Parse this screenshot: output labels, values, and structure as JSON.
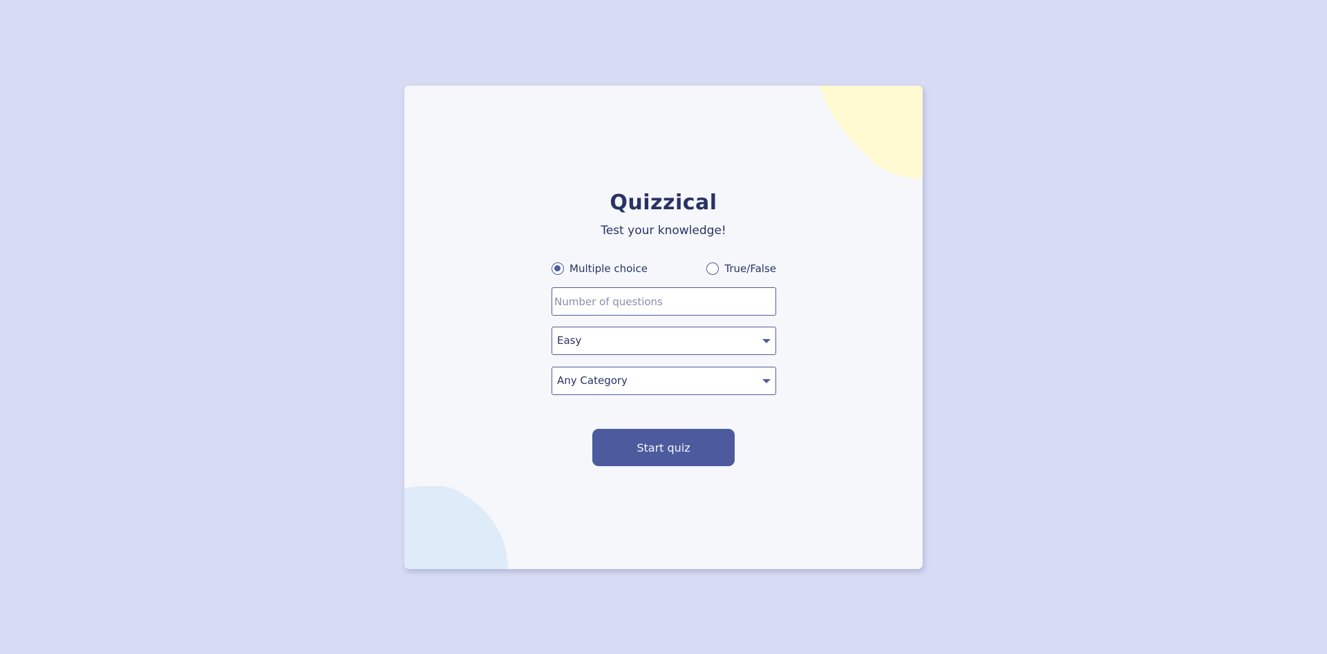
{
  "app": {
    "title": "Quizzical",
    "subtitle": "Test your knowledge!"
  },
  "question_type": {
    "options": [
      {
        "label": "Multiple choice",
        "selected": true
      },
      {
        "label": "True/False",
        "selected": false
      }
    ]
  },
  "number_of_questions": {
    "value": "",
    "placeholder": "Number of questions"
  },
  "difficulty": {
    "selected": "Easy"
  },
  "category": {
    "selected": "Any Category"
  },
  "start_button": {
    "label": "Start quiz"
  },
  "colors": {
    "page_background": "#d7dbf3",
    "card_background": "#f5f7fb",
    "accent": "#4d5b9e",
    "text": "#293264",
    "blob_yellow": "#fffad1",
    "blob_blue": "#deebf8"
  },
  "icons": {
    "select_caret": "caret-down-icon"
  }
}
